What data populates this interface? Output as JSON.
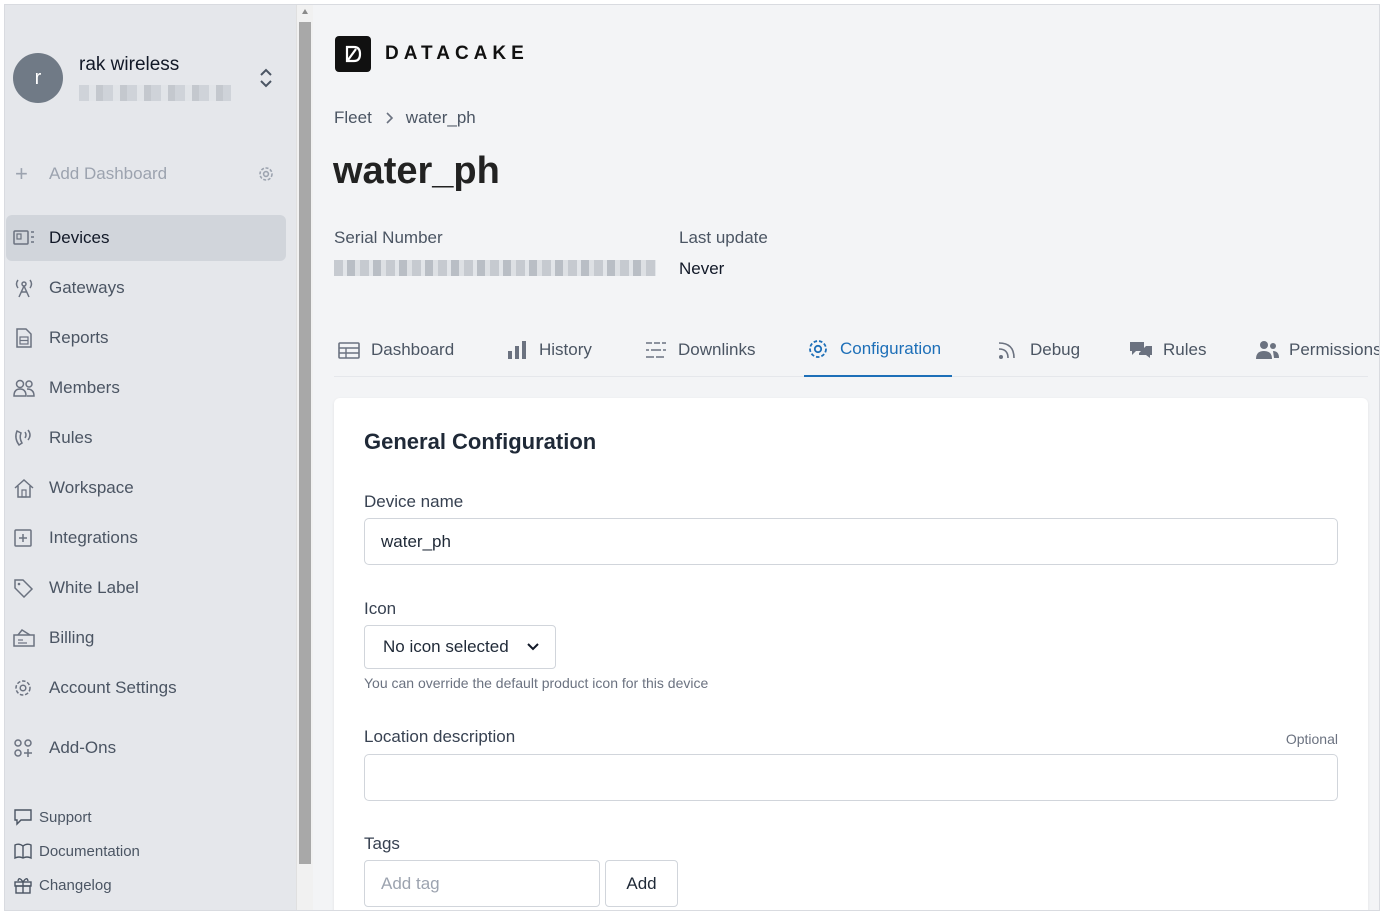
{
  "account": {
    "avatar_letter": "r",
    "name": "rak wireless",
    "email": "redacted-email"
  },
  "sidebar": {
    "add_dashboard": "Add Dashboard",
    "items": [
      {
        "label": "Devices",
        "icon": "devices-icon",
        "active": true
      },
      {
        "label": "Gateways",
        "icon": "gateway-icon"
      },
      {
        "label": "Reports",
        "icon": "report-icon"
      },
      {
        "label": "Members",
        "icon": "members-icon"
      },
      {
        "label": "Rules",
        "icon": "rules-icon"
      },
      {
        "label": "Workspace",
        "icon": "workspace-icon"
      },
      {
        "label": "Integrations",
        "icon": "integrations-icon"
      },
      {
        "label": "White Label",
        "icon": "tag-icon"
      },
      {
        "label": "Billing",
        "icon": "billing-icon"
      },
      {
        "label": "Account Settings",
        "icon": "gear-icon"
      },
      {
        "label": "Add-Ons",
        "icon": "addons-icon"
      }
    ],
    "footer": [
      {
        "label": "Support",
        "icon": "chat-icon"
      },
      {
        "label": "Documentation",
        "icon": "book-icon"
      },
      {
        "label": "Changelog",
        "icon": "gift-icon"
      }
    ]
  },
  "brand": {
    "name": "DATACAKE"
  },
  "breadcrumb": {
    "root": "Fleet",
    "current": "water_ph"
  },
  "page": {
    "title": "water_ph"
  },
  "meta": {
    "serial_label": "Serial Number",
    "serial_value": "redacted-serial",
    "last_update_label": "Last update",
    "last_update_value": "Never"
  },
  "tabs": [
    {
      "label": "Dashboard",
      "icon": "table-icon"
    },
    {
      "label": "History",
      "icon": "bar-chart-icon"
    },
    {
      "label": "Downlinks",
      "icon": "sliders-icon"
    },
    {
      "label": "Configuration",
      "icon": "gear-icon",
      "active": true
    },
    {
      "label": "Debug",
      "icon": "rss-icon"
    },
    {
      "label": "Rules",
      "icon": "chat-bubbles-icon"
    },
    {
      "label": "Permissions",
      "icon": "users-icon"
    }
  ],
  "config": {
    "title": "General Configuration",
    "device_name_label": "Device name",
    "device_name_value": "water_ph",
    "icon_label": "Icon",
    "icon_select": "No icon selected",
    "icon_help": "You can override the default product icon for this device",
    "location_label": "Location description",
    "location_optional": "Optional",
    "location_value": "",
    "tags_label": "Tags",
    "tag_placeholder": "Add tag",
    "add_button": "Add"
  },
  "colors": {
    "accent": "#1d6fb8",
    "sidebar_bg": "#e5e7eb",
    "active_item_bg": "#d1d5db"
  }
}
